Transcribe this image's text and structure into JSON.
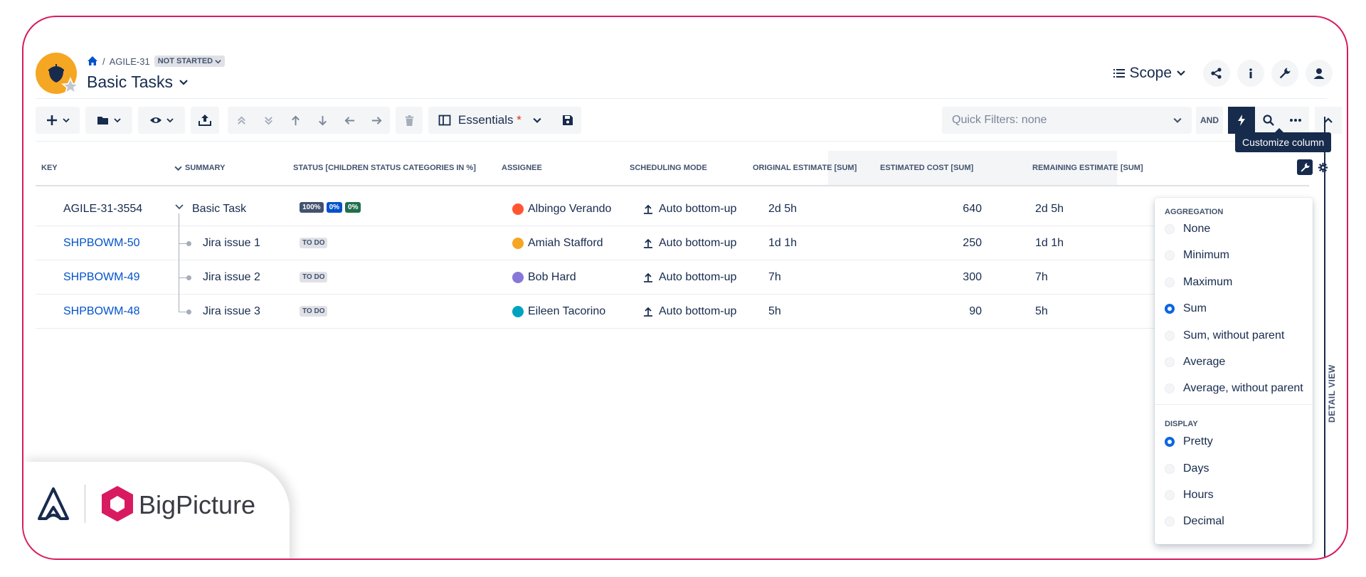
{
  "breadcrumb": {
    "project": "AGILE-31",
    "status": "NOT STARTED"
  },
  "header": {
    "title": "Basic Tasks",
    "scope_label": "Scope"
  },
  "toolbar": {
    "view_label": "Essentials",
    "view_modified": "*"
  },
  "quick_filters": {
    "label": "Quick Filters: none",
    "and_label": "AND"
  },
  "tooltip": "Customize column",
  "columns": {
    "key": "KEY",
    "summary": "SUMMARY",
    "status": "STATUS [CHILDREN STATUS CATEGORIES IN %]",
    "assignee": "ASSIGNEE",
    "scheduling": "SCHEDULING MODE",
    "original": "ORIGINAL ESTIMATE [SUM]",
    "cost": "ESTIMATED COST [SUM]",
    "remaining": "REMAINING ESTIMATE [SUM]"
  },
  "rows": [
    {
      "key": "AGILE-31-3554",
      "summary": "Basic Task",
      "status": [
        "100%",
        "0%",
        "0%"
      ],
      "assignee": "Albingo Verando",
      "scheduling": "Auto bottom-up",
      "original": "2d 5h",
      "cost": "640",
      "remaining": "2d 5h"
    },
    {
      "key": "SHPBOWM-50",
      "summary": "Jira issue 1",
      "status": "TO DO",
      "assignee": "Amiah Stafford",
      "scheduling": "Auto bottom-up",
      "original": "1d 1h",
      "cost": "250",
      "remaining": "1d 1h"
    },
    {
      "key": "SHPBOWM-49",
      "summary": "Jira issue 2",
      "status": "TO DO",
      "assignee": "Bob Hard",
      "scheduling": "Auto bottom-up",
      "original": "7h",
      "cost": "300",
      "remaining": "7h"
    },
    {
      "key": "SHPBOWM-48",
      "summary": "Jira issue 3",
      "status": "TO DO",
      "assignee": "Eileen Tacorino",
      "scheduling": "Auto bottom-up",
      "original": "5h",
      "cost": "90",
      "remaining": "5h"
    }
  ],
  "status_colors": {
    "done": "#42526e",
    "in_progress": "#0052cc",
    "todo_green": "#216e4e"
  },
  "dropdown": {
    "aggregation_title": "AGGREGATION",
    "aggregation": [
      "None",
      "Minimum",
      "Maximum",
      "Sum",
      "Sum, without parent",
      "Average",
      "Average, without parent"
    ],
    "aggregation_selected": "Sum",
    "display_title": "DISPLAY",
    "display": [
      "Pretty",
      "Days",
      "Hours",
      "Decimal"
    ],
    "display_selected": "Pretty"
  },
  "detail_view": "DETAIL VIEW",
  "brand": {
    "name": "BigPicture",
    "accent": "#d81b60"
  }
}
